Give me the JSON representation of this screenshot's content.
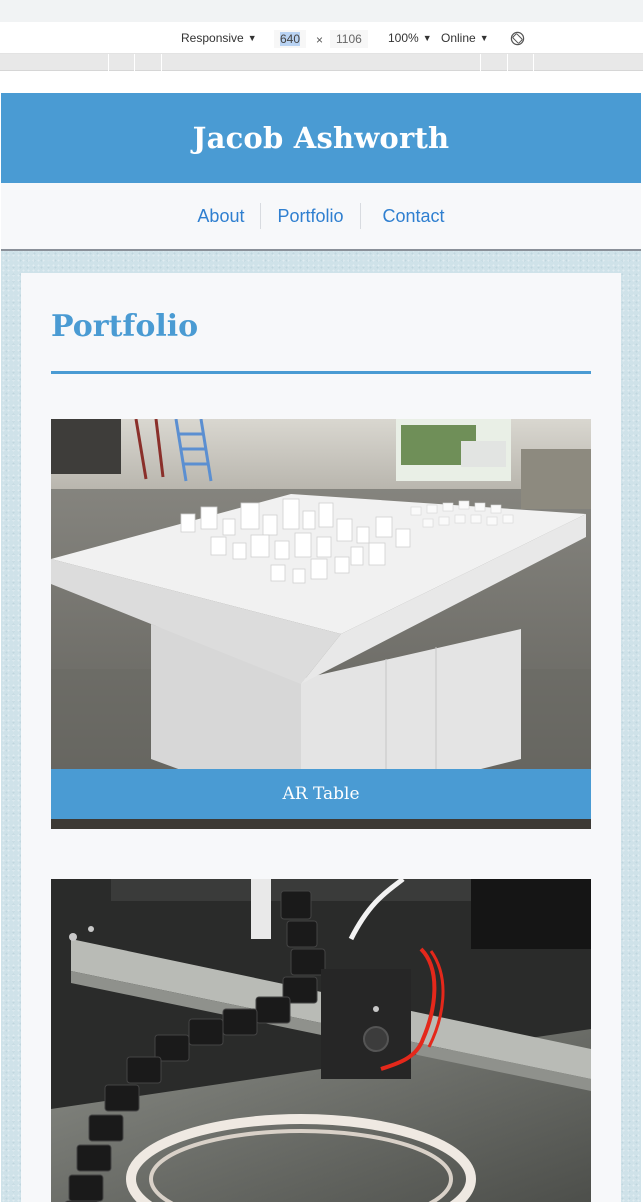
{
  "devtools": {
    "device_mode": "Responsive",
    "width": "640",
    "height": "1106",
    "zoom": "100%",
    "network": "Online",
    "icons": [
      "caret-down-icon",
      "rotate-icon"
    ]
  },
  "site": {
    "title": "Jacob Ashworth",
    "nav": [
      "About",
      "Portfolio",
      "Contact"
    ],
    "accent_color": "#4a9bd3",
    "link_color": "#2f7fd0"
  },
  "main": {
    "heading": "Portfolio",
    "projects": [
      {
        "caption": "AR Table"
      },
      {
        "caption": ""
      }
    ]
  }
}
